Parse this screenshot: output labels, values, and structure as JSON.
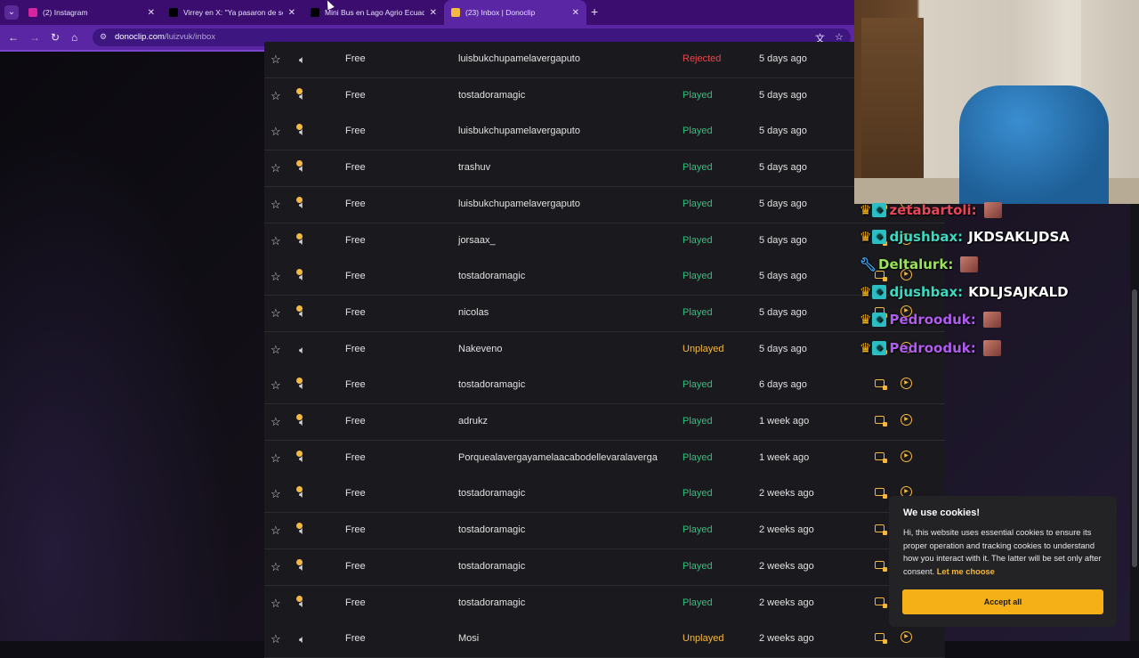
{
  "browser": {
    "tabs": [
      {
        "title": "(2) Instagram",
        "favicon": "instagram-icon",
        "color": "#d6249f",
        "active": false
      },
      {
        "title": "Virrey en X: \"Ya pasaron de ser",
        "favicon": "x-icon",
        "color": "#000000",
        "active": false
      },
      {
        "title": "Mini Bus en Lago Agrio Ecuado",
        "favicon": "tiktok-icon",
        "color": "#000000",
        "active": false
      },
      {
        "title": "(23) Inbox | Donoclip",
        "favicon": "donoclip-icon",
        "color": "#f5b941",
        "active": true
      }
    ],
    "url_domain": "donoclip.com",
    "url_path": "/luizvuk/inbox"
  },
  "inbox": {
    "rows": [
      {
        "tier": "Free",
        "user": "luisbukchupamelavergaputo",
        "status": "Rejected",
        "time": "5 days ago",
        "played_dot": false
      },
      {
        "tier": "Free",
        "user": "tostadoramagic",
        "status": "Played",
        "time": "5 days ago",
        "played_dot": true
      },
      {
        "tier": "Free",
        "user": "luisbukchupamelavergaputo",
        "status": "Played",
        "time": "5 days ago",
        "played_dot": true
      },
      {
        "tier": "Free",
        "user": "trashuv",
        "status": "Played",
        "time": "5 days ago",
        "played_dot": true
      },
      {
        "tier": "Free",
        "user": "luisbukchupamelavergaputo",
        "status": "Played",
        "time": "5 days ago",
        "played_dot": true
      },
      {
        "tier": "Free",
        "user": "jorsaax_",
        "status": "Played",
        "time": "5 days ago",
        "played_dot": true
      },
      {
        "tier": "Free",
        "user": "tostadoramagic",
        "status": "Played",
        "time": "5 days ago",
        "played_dot": true
      },
      {
        "tier": "Free",
        "user": "nicolas",
        "status": "Played",
        "time": "5 days ago",
        "played_dot": true
      },
      {
        "tier": "Free",
        "user": "Nakeveno",
        "status": "Unplayed",
        "time": "5 days ago",
        "played_dot": false
      },
      {
        "tier": "Free",
        "user": "tostadoramagic",
        "status": "Played",
        "time": "6 days ago",
        "played_dot": true
      },
      {
        "tier": "Free",
        "user": "adrukz",
        "status": "Played",
        "time": "1 week ago",
        "played_dot": true
      },
      {
        "tier": "Free",
        "user": "Porquealavergayamelaacabodellevaralaverga",
        "status": "Played",
        "time": "1 week ago",
        "played_dot": true
      },
      {
        "tier": "Free",
        "user": "tostadoramagic",
        "status": "Played",
        "time": "2 weeks ago",
        "played_dot": true
      },
      {
        "tier": "Free",
        "user": "tostadoramagic",
        "status": "Played",
        "time": "2 weeks ago",
        "played_dot": true
      },
      {
        "tier": "Free",
        "user": "tostadoramagic",
        "status": "Played",
        "time": "2 weeks ago",
        "played_dot": true
      },
      {
        "tier": "Free",
        "user": "tostadoramagic",
        "status": "Played",
        "time": "2 weeks ago",
        "played_dot": true
      },
      {
        "tier": "Free",
        "user": "Mosi",
        "status": "Unplayed",
        "time": "2 weeks ago",
        "played_dot": false
      }
    ],
    "status_colors": {
      "Played": "#2ec27e",
      "Rejected": "#e5484d",
      "Unplayed": "#f5b941"
    }
  },
  "chat": {
    "messages": [
      {
        "user": "zetabartoli",
        "color": "#e8465a",
        "badges": [
          "crown-icon",
          "badge-icon"
        ],
        "text": "",
        "emote": true
      },
      {
        "user": "djushbax",
        "color": "#3fd9c1",
        "badges": [
          "crown-icon",
          "badge-icon"
        ],
        "text": "JKDSAKLJDSA",
        "emote": false
      },
      {
        "user": "Deltalurk",
        "color": "#9be35a",
        "badges": [
          "wrench-icon"
        ],
        "text": "",
        "emote": true
      },
      {
        "user": "djushbax",
        "color": "#3fd9c1",
        "badges": [
          "crown-icon",
          "badge-icon"
        ],
        "text": "KDLJSAJKALD",
        "emote": false
      },
      {
        "user": "Pedrooduk",
        "color": "#b15cf0",
        "badges": [
          "crown-icon",
          "badge-icon"
        ],
        "text": "",
        "emote": true
      },
      {
        "user": "Pedrooduk",
        "color": "#b15cf0",
        "badges": [
          "crown-icon",
          "badge-icon"
        ],
        "text": "",
        "emote": true
      }
    ]
  },
  "cookie": {
    "title": "We use cookies!",
    "text": "Hi, this website uses essential cookies to ensure its proper operation and tracking cookies to understand how you interact with it. The latter will be set only after consent.",
    "link": "Let me choose",
    "accept": "Accept all"
  }
}
